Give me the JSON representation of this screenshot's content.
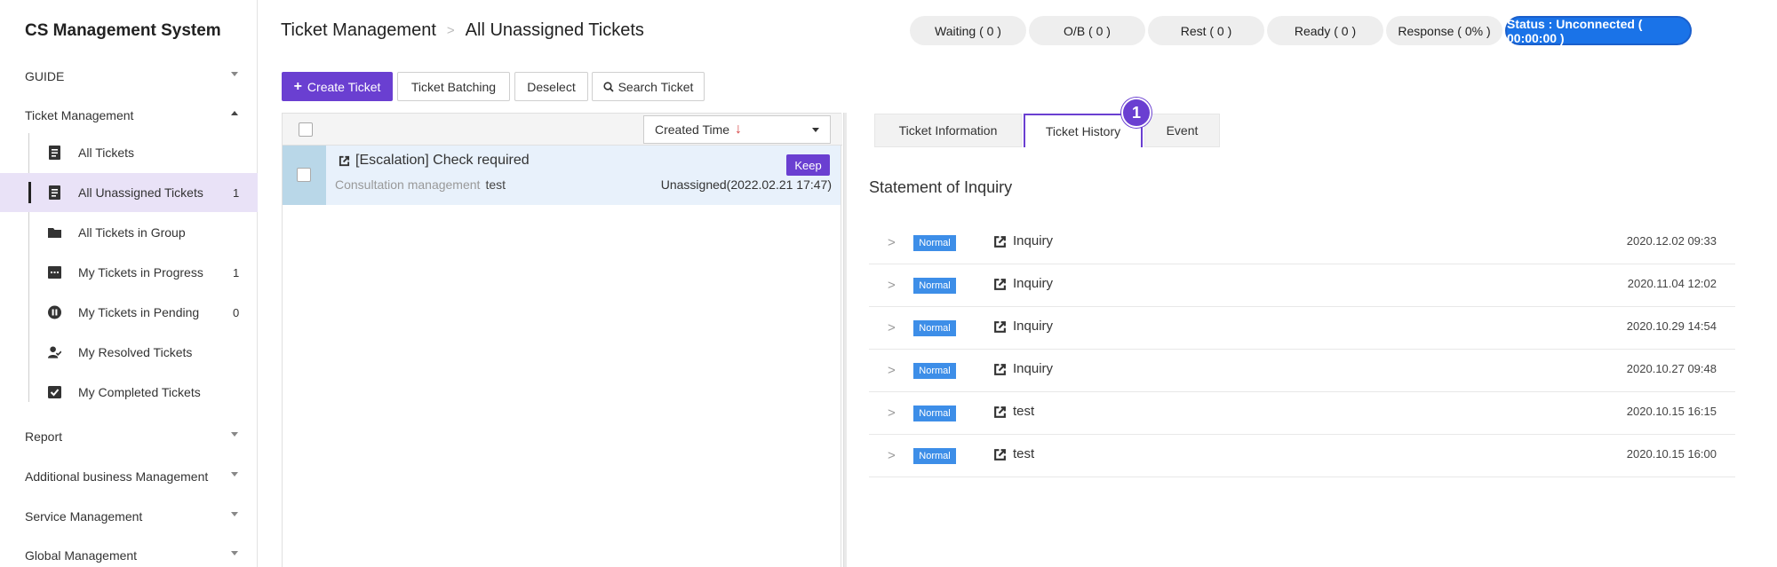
{
  "app": {
    "title": "CS Management System"
  },
  "sidebar": {
    "sections": [
      {
        "label": "GUIDE"
      },
      {
        "label": "Ticket Management"
      },
      {
        "label": "Report"
      },
      {
        "label": "Additional business Management"
      },
      {
        "label": "Service Management"
      },
      {
        "label": "Global Management"
      }
    ],
    "ticket_items": [
      {
        "label": "All Tickets",
        "icon": "document-icon",
        "count": ""
      },
      {
        "label": "All Unassigned Tickets",
        "icon": "document-icon",
        "count": "1"
      },
      {
        "label": "All Tickets in Group",
        "icon": "folder-icon",
        "count": ""
      },
      {
        "label": "My Tickets in Progress",
        "icon": "chat-icon",
        "count": "1"
      },
      {
        "label": "My Tickets in Pending",
        "icon": "pause-icon",
        "count": "0"
      },
      {
        "label": "My Resolved Tickets",
        "icon": "user-check-icon",
        "count": ""
      },
      {
        "label": "My Completed Tickets",
        "icon": "checkbox-icon",
        "count": ""
      }
    ]
  },
  "header": {
    "breadcrumb": [
      "Ticket Management",
      "All Unassigned Tickets"
    ],
    "statuses": [
      {
        "label": "Waiting ( 0 )"
      },
      {
        "label": "O/B ( 0 )"
      },
      {
        "label": "Rest ( 0 )"
      },
      {
        "label": "Ready ( 0 )"
      },
      {
        "label": "Response ( 0% )"
      },
      {
        "label": "Status : Unconnected ( 00:00:00 )"
      }
    ]
  },
  "toolbar": {
    "create": "Create Ticket",
    "batching": "Ticket Batching",
    "deselect": "Deselect",
    "search": "Search Ticket"
  },
  "ticket_list": {
    "sort": {
      "label": "Created Time",
      "direction": "↓"
    },
    "tickets": [
      {
        "title": "[Escalation] Check required",
        "category": "Consultation management",
        "customer": "test",
        "badge": "Keep",
        "status": "Unassigned(2022.02.21 17:47)"
      }
    ]
  },
  "detail": {
    "tabs": [
      {
        "label": "Ticket Information"
      },
      {
        "label": "Ticket History"
      },
      {
        "label": "Event"
      }
    ],
    "step_marker": "1",
    "section_title": "Statement of Inquiry",
    "history": [
      {
        "status": "Normal",
        "label": "Inquiry",
        "date": "2020.12.02 09:33"
      },
      {
        "status": "Normal",
        "label": "Inquiry",
        "date": "2020.11.04 12:02"
      },
      {
        "status": "Normal",
        "label": "Inquiry",
        "date": "2020.10.29 14:54"
      },
      {
        "status": "Normal",
        "label": "Inquiry",
        "date": "2020.10.27 09:48"
      },
      {
        "status": "Normal",
        "label": "test",
        "date": "2020.10.15 16:15"
      },
      {
        "status": "Normal",
        "label": "test",
        "date": "2020.10.15 16:00"
      }
    ]
  },
  "colors": {
    "accent": "#6a3fd1",
    "status_primary": "#1a73e8",
    "badge_normal": "#3d8ee8",
    "active_row": "#e9e2f7"
  }
}
